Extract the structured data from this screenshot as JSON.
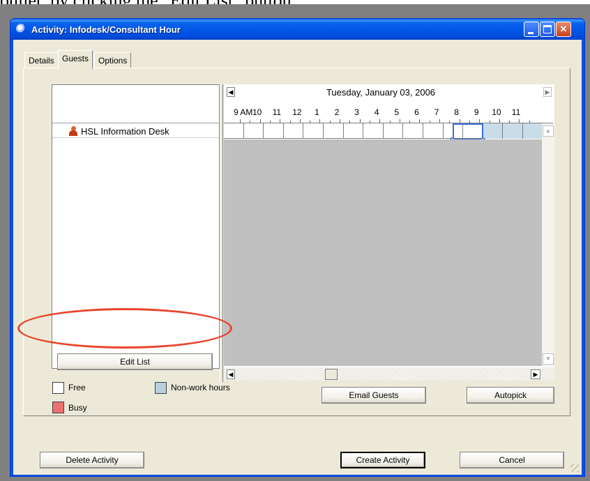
{
  "caption": {
    "text": "ouliet, by clicking the \"Edit List\" button"
  },
  "window": {
    "title": "Activity: Infodesk/Consultant Hour",
    "icon": "clock-icon"
  },
  "tabs": [
    {
      "label": "Details",
      "active": false
    },
    {
      "label": "Guests",
      "active": true
    },
    {
      "label": "Options",
      "active": false
    }
  ],
  "guests": {
    "items": [
      {
        "name": "HSL Information Desk",
        "icon": "resource-person-icon"
      }
    ],
    "edit_list_label": "Edit List"
  },
  "schedule": {
    "date": "Tuesday, January 03, 2006",
    "hours": [
      "9 AM",
      "10",
      "11",
      "12",
      "1",
      "2",
      "3",
      "4",
      "5",
      "6",
      "7",
      "8",
      "9",
      "10",
      "11"
    ]
  },
  "legend": [
    {
      "label": "Free",
      "color": "#ffffff"
    },
    {
      "label": "Non-work hours",
      "color": "#b8cfe0"
    },
    {
      "label": "Busy",
      "color": "#f07070"
    }
  ],
  "buttons": {
    "email_guests": "Email Guests",
    "autopick": "Autopick",
    "delete_activity": "Delete Activity",
    "create_activity": "Create Activity",
    "cancel": "Cancel"
  },
  "colors": {
    "title_bar": "#0054e3",
    "dialog_bg": "#ece9d8",
    "highlight_oval": "#e8452e",
    "selection": "#3a6de0"
  }
}
